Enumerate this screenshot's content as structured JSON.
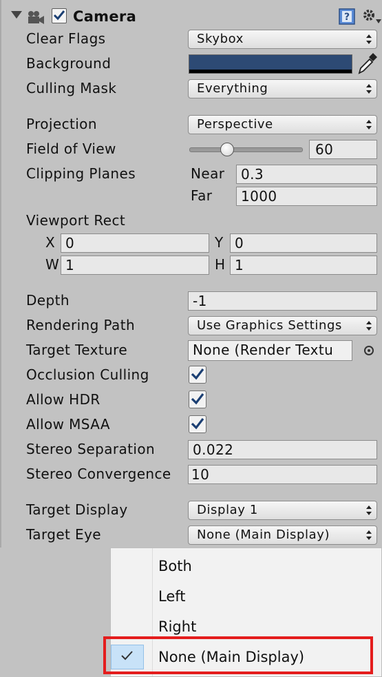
{
  "component": {
    "title": "Camera",
    "enabled": true
  },
  "clear_flags": {
    "label": "Clear Flags",
    "value": "Skybox"
  },
  "background": {
    "label": "Background",
    "color": "#2d4a74"
  },
  "culling_mask": {
    "label": "Culling Mask",
    "value": "Everything"
  },
  "projection": {
    "label": "Projection",
    "value": "Perspective"
  },
  "field_of_view": {
    "label": "Field of View",
    "value": "60"
  },
  "clipping_planes": {
    "label": "Clipping Planes",
    "near_label": "Near",
    "near": "0.3",
    "far_label": "Far",
    "far": "1000"
  },
  "viewport_rect": {
    "label": "Viewport Rect",
    "x_label": "X",
    "x": "0",
    "y_label": "Y",
    "y": "0",
    "w_label": "W",
    "w": "1",
    "h_label": "H",
    "h": "1"
  },
  "depth": {
    "label": "Depth",
    "value": "-1"
  },
  "rendering_path": {
    "label": "Rendering Path",
    "value": "Use Graphics Settings"
  },
  "target_texture": {
    "label": "Target Texture",
    "value": "None (Render Textu"
  },
  "occlusion_culling": {
    "label": "Occlusion Culling",
    "checked": true
  },
  "allow_hdr": {
    "label": "Allow HDR",
    "checked": true
  },
  "allow_msaa": {
    "label": "Allow MSAA",
    "checked": true
  },
  "stereo_separation": {
    "label": "Stereo Separation",
    "value": "0.022"
  },
  "stereo_convergence": {
    "label": "Stereo Convergence",
    "value": "10"
  },
  "target_display": {
    "label": "Target Display",
    "value": "Display 1"
  },
  "target_eye": {
    "label": "Target Eye",
    "value": "None (Main Display)"
  },
  "menu": {
    "items": [
      {
        "label": "Both",
        "selected": false
      },
      {
        "label": "Left",
        "selected": false
      },
      {
        "label": "Right",
        "selected": false
      },
      {
        "label": "None (Main Display)",
        "selected": true
      }
    ]
  },
  "colors": {
    "panel": "#c2c2c2",
    "highlight": "#e41d1d",
    "menu_selected": "#c8e2f8",
    "check": "#1b3f73"
  }
}
